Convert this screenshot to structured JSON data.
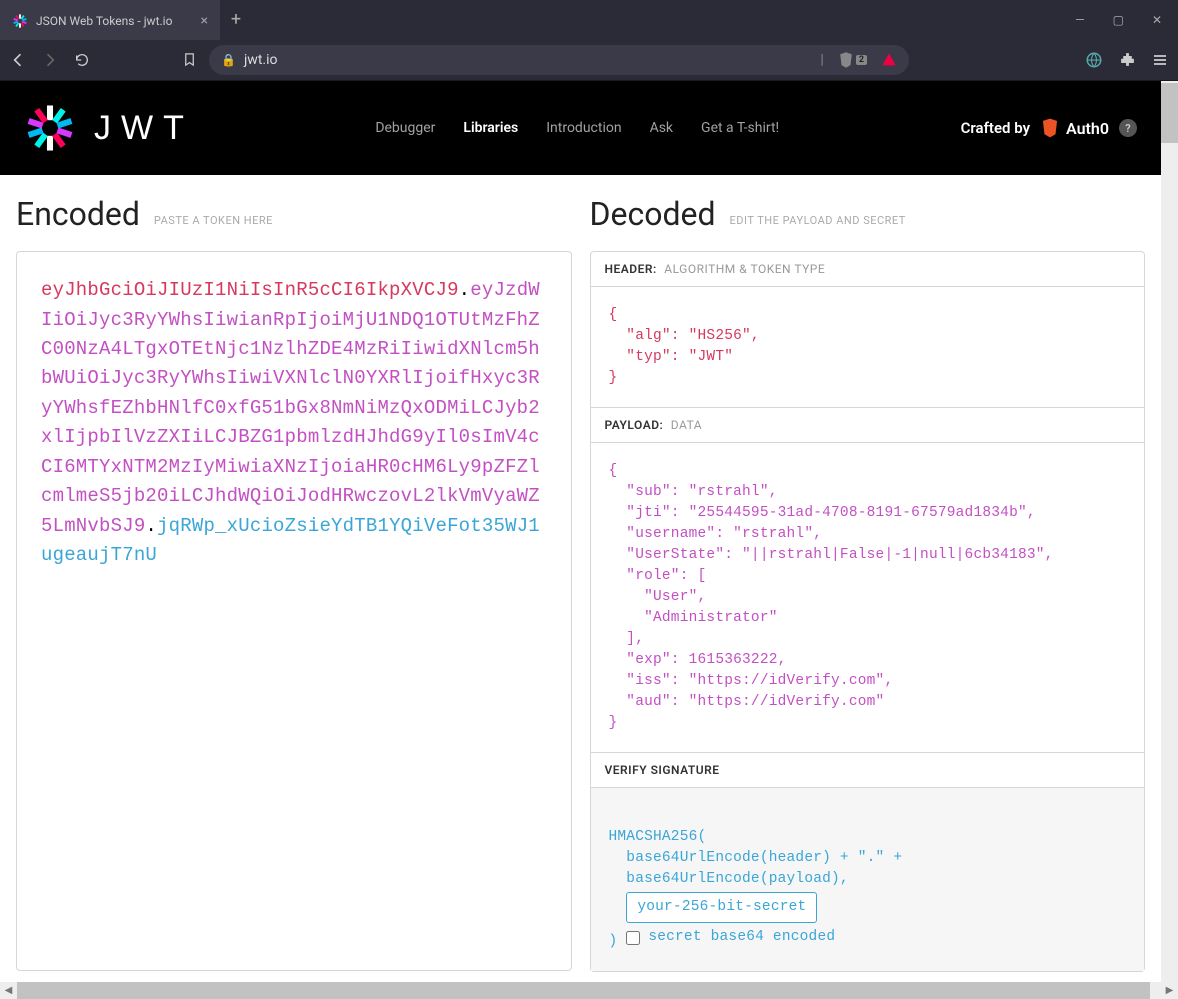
{
  "browser": {
    "tab_title": "JSON Web Tokens - jwt.io",
    "url": "jwt.io",
    "shield_count": "2"
  },
  "header": {
    "logo_text": "JWT",
    "nav": {
      "debugger": "Debugger",
      "libraries": "Libraries",
      "introduction": "Introduction",
      "ask": "Ask",
      "tshirt": "Get a T-shirt!"
    },
    "crafted_by": "Crafted by",
    "auth0": "Auth0",
    "help": "?"
  },
  "encoded": {
    "title": "Encoded",
    "hint": "PASTE A TOKEN HERE",
    "token_header": "eyJhbGciOiJIUzI1NiIsInR5cCI6IkpXVCJ9",
    "token_payload": "eyJzdWIiOiJyc3RyYWhsIiwianRpIjoiMjU1NDQ1OTUtMzFhZC00NzA4LTgxOTEtNjc1NzlhZDE4MzRiIiwidXNlcm5hbWUiOiJyc3RyYWhsIiwiVXNlclN0YXRlIjoifHxyc3RyYWhsfEZhbHNlfC0xfG51bGx8NmNiMzQxODMiLCJyb2xlIjpbIlVzZXIiLCJBZG1pbmlzdHJhdG9yIl0sImV4cCI6MTYxNTM2MzIyMiwiaXNzIjoiaHR0cHM6Ly9pZFZlcmlmeS5jb20iLCJhdWQiOiJodHRwczovL2lkVmVyaWZ5LmNvbSJ9",
    "token_sig": "jqRWp_xUcioZsieYdTB1YQiVeFot35WJ1ugeaujT7nU",
    "dot": "."
  },
  "decoded": {
    "title": "Decoded",
    "hint": "EDIT THE PAYLOAD AND SECRET",
    "header_section": {
      "label": "HEADER:",
      "sub": "ALGORITHM & TOKEN TYPE",
      "json": "{\n  \"alg\": \"HS256\",\n  \"typ\": \"JWT\"\n}"
    },
    "payload_section": {
      "label": "PAYLOAD:",
      "sub": "DATA",
      "json": "{\n  \"sub\": \"rstrahl\",\n  \"jti\": \"25544595-31ad-4708-8191-67579ad1834b\",\n  \"username\": \"rstrahl\",\n  \"UserState\": \"||rstrahl|False|-1|null|6cb34183\",\n  \"role\": [\n    \"User\",\n    \"Administrator\"\n  ],\n  \"exp\": 1615363222,\n  \"iss\": \"https://idVerify.com\",\n  \"aud\": \"https://idVerify.com\"\n}"
    },
    "sig_section": {
      "label": "VERIFY SIGNATURE",
      "line1": "HMACSHA256(",
      "line2": "  base64UrlEncode(header) + \".\" +",
      "line3": "  base64UrlEncode(payload),",
      "secret_placeholder": "your-256-bit-secret",
      "close_paren": ")",
      "checkbox_label": "secret base64 encoded"
    }
  }
}
